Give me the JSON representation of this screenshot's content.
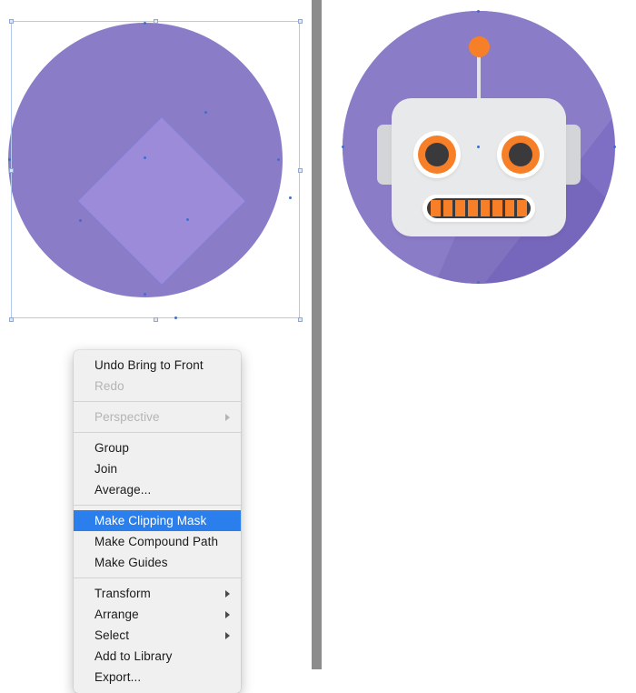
{
  "app": {
    "kind": "vector-graphics-editor",
    "divider_color": "#8c8c8c"
  },
  "left_artboard": {
    "name": "vector-editing-canvas",
    "selection": {
      "bbox_stroke_color": "#b3c9ee",
      "handle_fill_color": "#dfe8f7",
      "anchor_color": "#3f6fd0"
    },
    "shapes": [
      {
        "name": "circle",
        "fill": "#8b7cc8",
        "label": "Ellipse"
      },
      {
        "name": "rotated-square",
        "fill": "#b4a0f0",
        "opacity": "0.42",
        "rotation_deg": 45,
        "label": "Rectangle (rotated 45°)"
      }
    ]
  },
  "right_artboard": {
    "name": "robot-icon-preview",
    "illustration": {
      "title": "Robot Head Icon",
      "background_circle": "#7f6fc4",
      "background_circle_light": "#8b7cc8",
      "head_color": "#e8e9ea",
      "ear_color": "#d3d5d8",
      "accent_color": "#f77f28",
      "dark_color": "#3a3a3c",
      "eye_white": "#ffffff",
      "teeth_count": 8
    }
  },
  "context_menu": {
    "name": "canvas-context-menu",
    "highlight_color": "#2b7fec",
    "background_color": "#f0f0f0",
    "groups": [
      {
        "items": [
          {
            "label": "Undo Bring to Front",
            "state": "enabled",
            "submenu": false
          },
          {
            "label": "Redo",
            "state": "disabled",
            "submenu": false
          }
        ]
      },
      {
        "items": [
          {
            "label": "Perspective",
            "state": "disabled",
            "submenu": true
          }
        ]
      },
      {
        "items": [
          {
            "label": "Group",
            "state": "enabled",
            "submenu": false
          },
          {
            "label": "Join",
            "state": "enabled",
            "submenu": false
          },
          {
            "label": "Average...",
            "state": "enabled",
            "submenu": false
          }
        ]
      },
      {
        "items": [
          {
            "label": "Make Clipping Mask",
            "state": "highlighted",
            "submenu": false
          },
          {
            "label": "Make Compound Path",
            "state": "enabled",
            "submenu": false
          },
          {
            "label": "Make Guides",
            "state": "enabled",
            "submenu": false
          }
        ]
      },
      {
        "items": [
          {
            "label": "Transform",
            "state": "enabled",
            "submenu": true
          },
          {
            "label": "Arrange",
            "state": "enabled",
            "submenu": true
          },
          {
            "label": "Select",
            "state": "enabled",
            "submenu": true
          },
          {
            "label": "Add to Library",
            "state": "enabled",
            "submenu": false
          },
          {
            "label": "Export...",
            "state": "enabled",
            "submenu": false
          }
        ]
      }
    ]
  }
}
